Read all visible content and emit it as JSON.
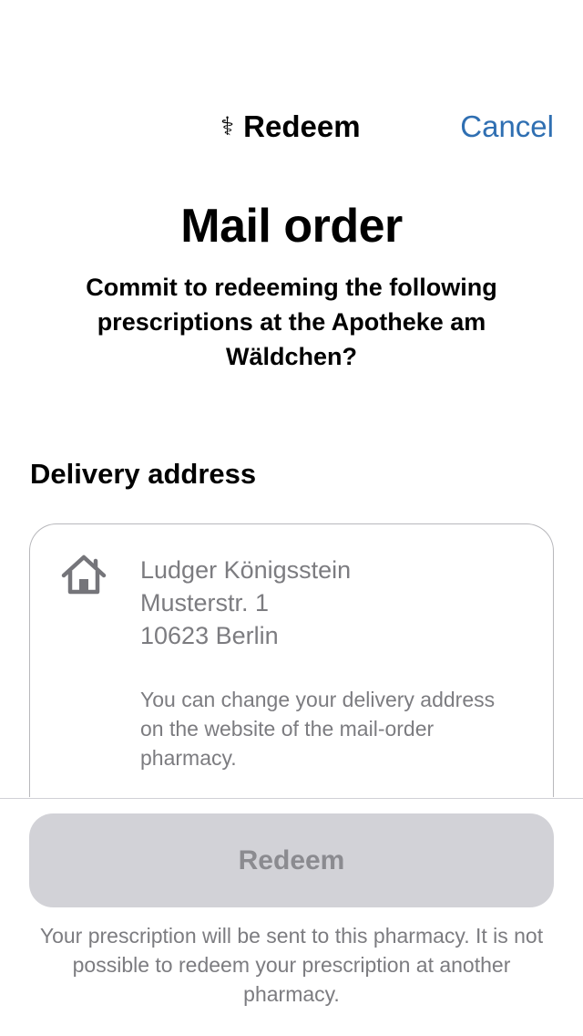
{
  "nav": {
    "icon": "caduceus-icon",
    "title": "Redeem",
    "cancel_label": "Cancel",
    "accent_color": "#2f6fb2"
  },
  "main": {
    "title": "Mail order",
    "subtitle": "Commit to redeeming the following prescriptions at the Apotheke am Wäldchen?"
  },
  "delivery": {
    "section_title": "Delivery address",
    "icon": "home-icon",
    "name": "Ludger Königsstein",
    "street": "Musterstr. 1",
    "city": "10623 Berlin",
    "note": "You can change your delivery address on the website of the mail-order pharmacy."
  },
  "action": {
    "redeem_label": "Redeem",
    "disabled": true,
    "footer_note": "Your prescription will be sent to this pharmacy. It is not possible to redeem your prescription at another pharmacy."
  }
}
